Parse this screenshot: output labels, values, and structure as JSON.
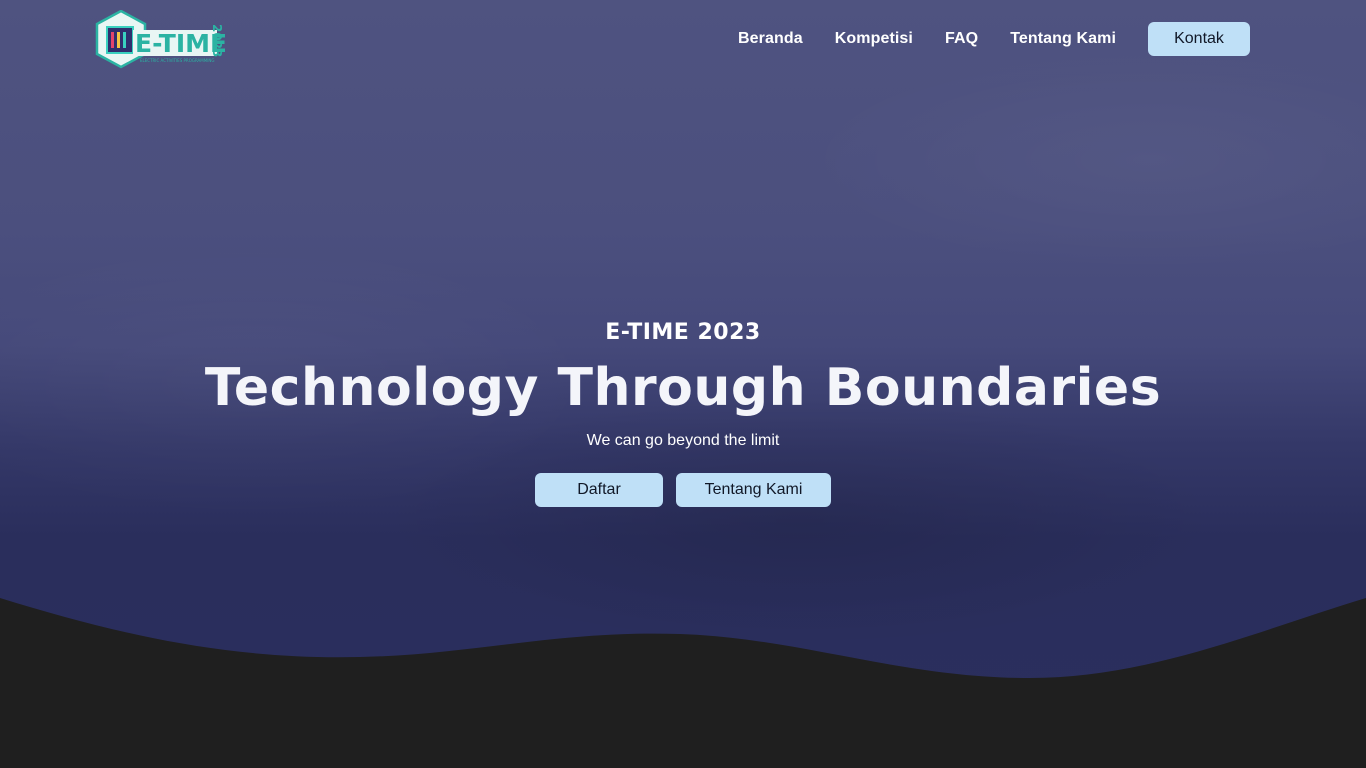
{
  "logo": {
    "wordmark": "E-TIME",
    "year": "2023",
    "subtitle": "ELECTRIC ACTIVITIES PROGRAMMING"
  },
  "nav": {
    "links": [
      "Beranda",
      "Kompetisi",
      "FAQ",
      "Tentang Kami"
    ],
    "contact_label": "Kontak"
  },
  "hero": {
    "eyebrow": "E-TIME 2023",
    "headline": "Technology Through Boundaries",
    "tagline": "We can go beyond the limit",
    "primary_button": "Daftar",
    "secondary_button": "Tentang Kami"
  },
  "colors": {
    "hero_top": "#4f5380",
    "hero_bottom": "#2b2f5e",
    "dark_section": "#1f1f1f",
    "button_bg": "#bfe0f7",
    "logo_teal": "#2bb3a3"
  }
}
